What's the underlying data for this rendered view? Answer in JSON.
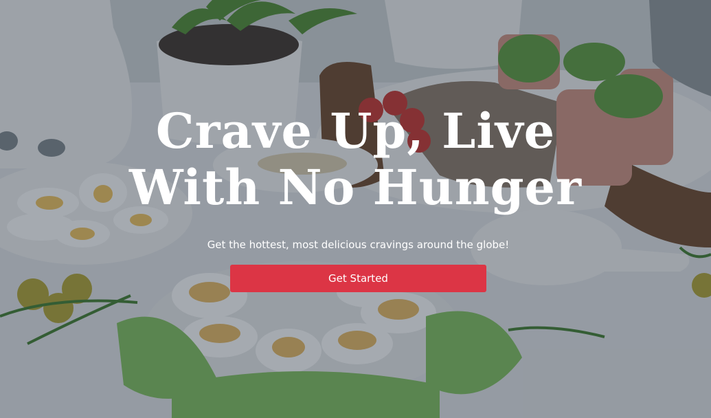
{
  "hero": {
    "headline_line1": "Crave Up, Live",
    "headline_line2": "With No Hunger",
    "subtitle": "Get the hottest, most delicious cravings around the globe!",
    "cta_label": "Get Started"
  },
  "colors": {
    "cta_background": "#dc3545",
    "text": "#ffffff",
    "overlay": "#283442"
  },
  "background": {
    "description_icon": "food-table-photo"
  }
}
